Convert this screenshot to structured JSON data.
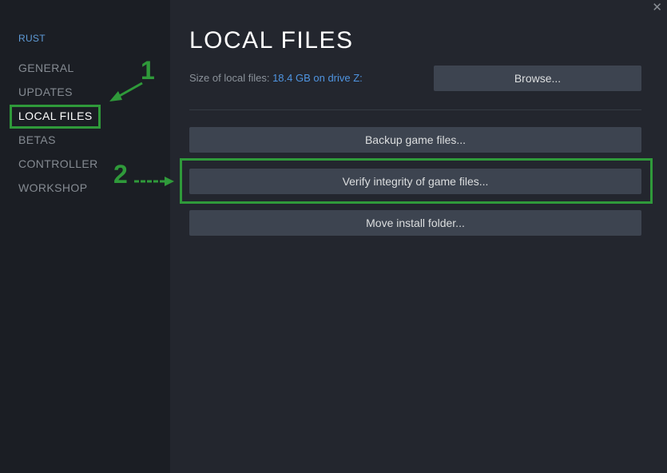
{
  "window": {
    "close_glyph": "✕"
  },
  "sidebar": {
    "game_title": "RUST",
    "items": [
      {
        "label": "GENERAL",
        "active": false
      },
      {
        "label": "UPDATES",
        "active": false
      },
      {
        "label": "LOCAL FILES",
        "active": true
      },
      {
        "label": "BETAS",
        "active": false
      },
      {
        "label": "CONTROLLER",
        "active": false
      },
      {
        "label": "WORKSHOP",
        "active": false
      }
    ]
  },
  "main": {
    "title": "LOCAL FILES",
    "size_label": "Size of local files:",
    "size_value": "18.4 GB on drive Z:",
    "browse_label": "Browse...",
    "backup_label": "Backup game files...",
    "verify_label": "Verify integrity of game files...",
    "move_label": "Move install folder..."
  },
  "annotations": {
    "step1": "1",
    "step2": "2",
    "color": "#2f9a3a"
  },
  "colors": {
    "sidebar_bg": "#1b1e24",
    "main_bg": "#23262e",
    "button_bg": "#3d4450",
    "link_blue": "#4f94e0",
    "title_blue": "#5f9cd8"
  }
}
